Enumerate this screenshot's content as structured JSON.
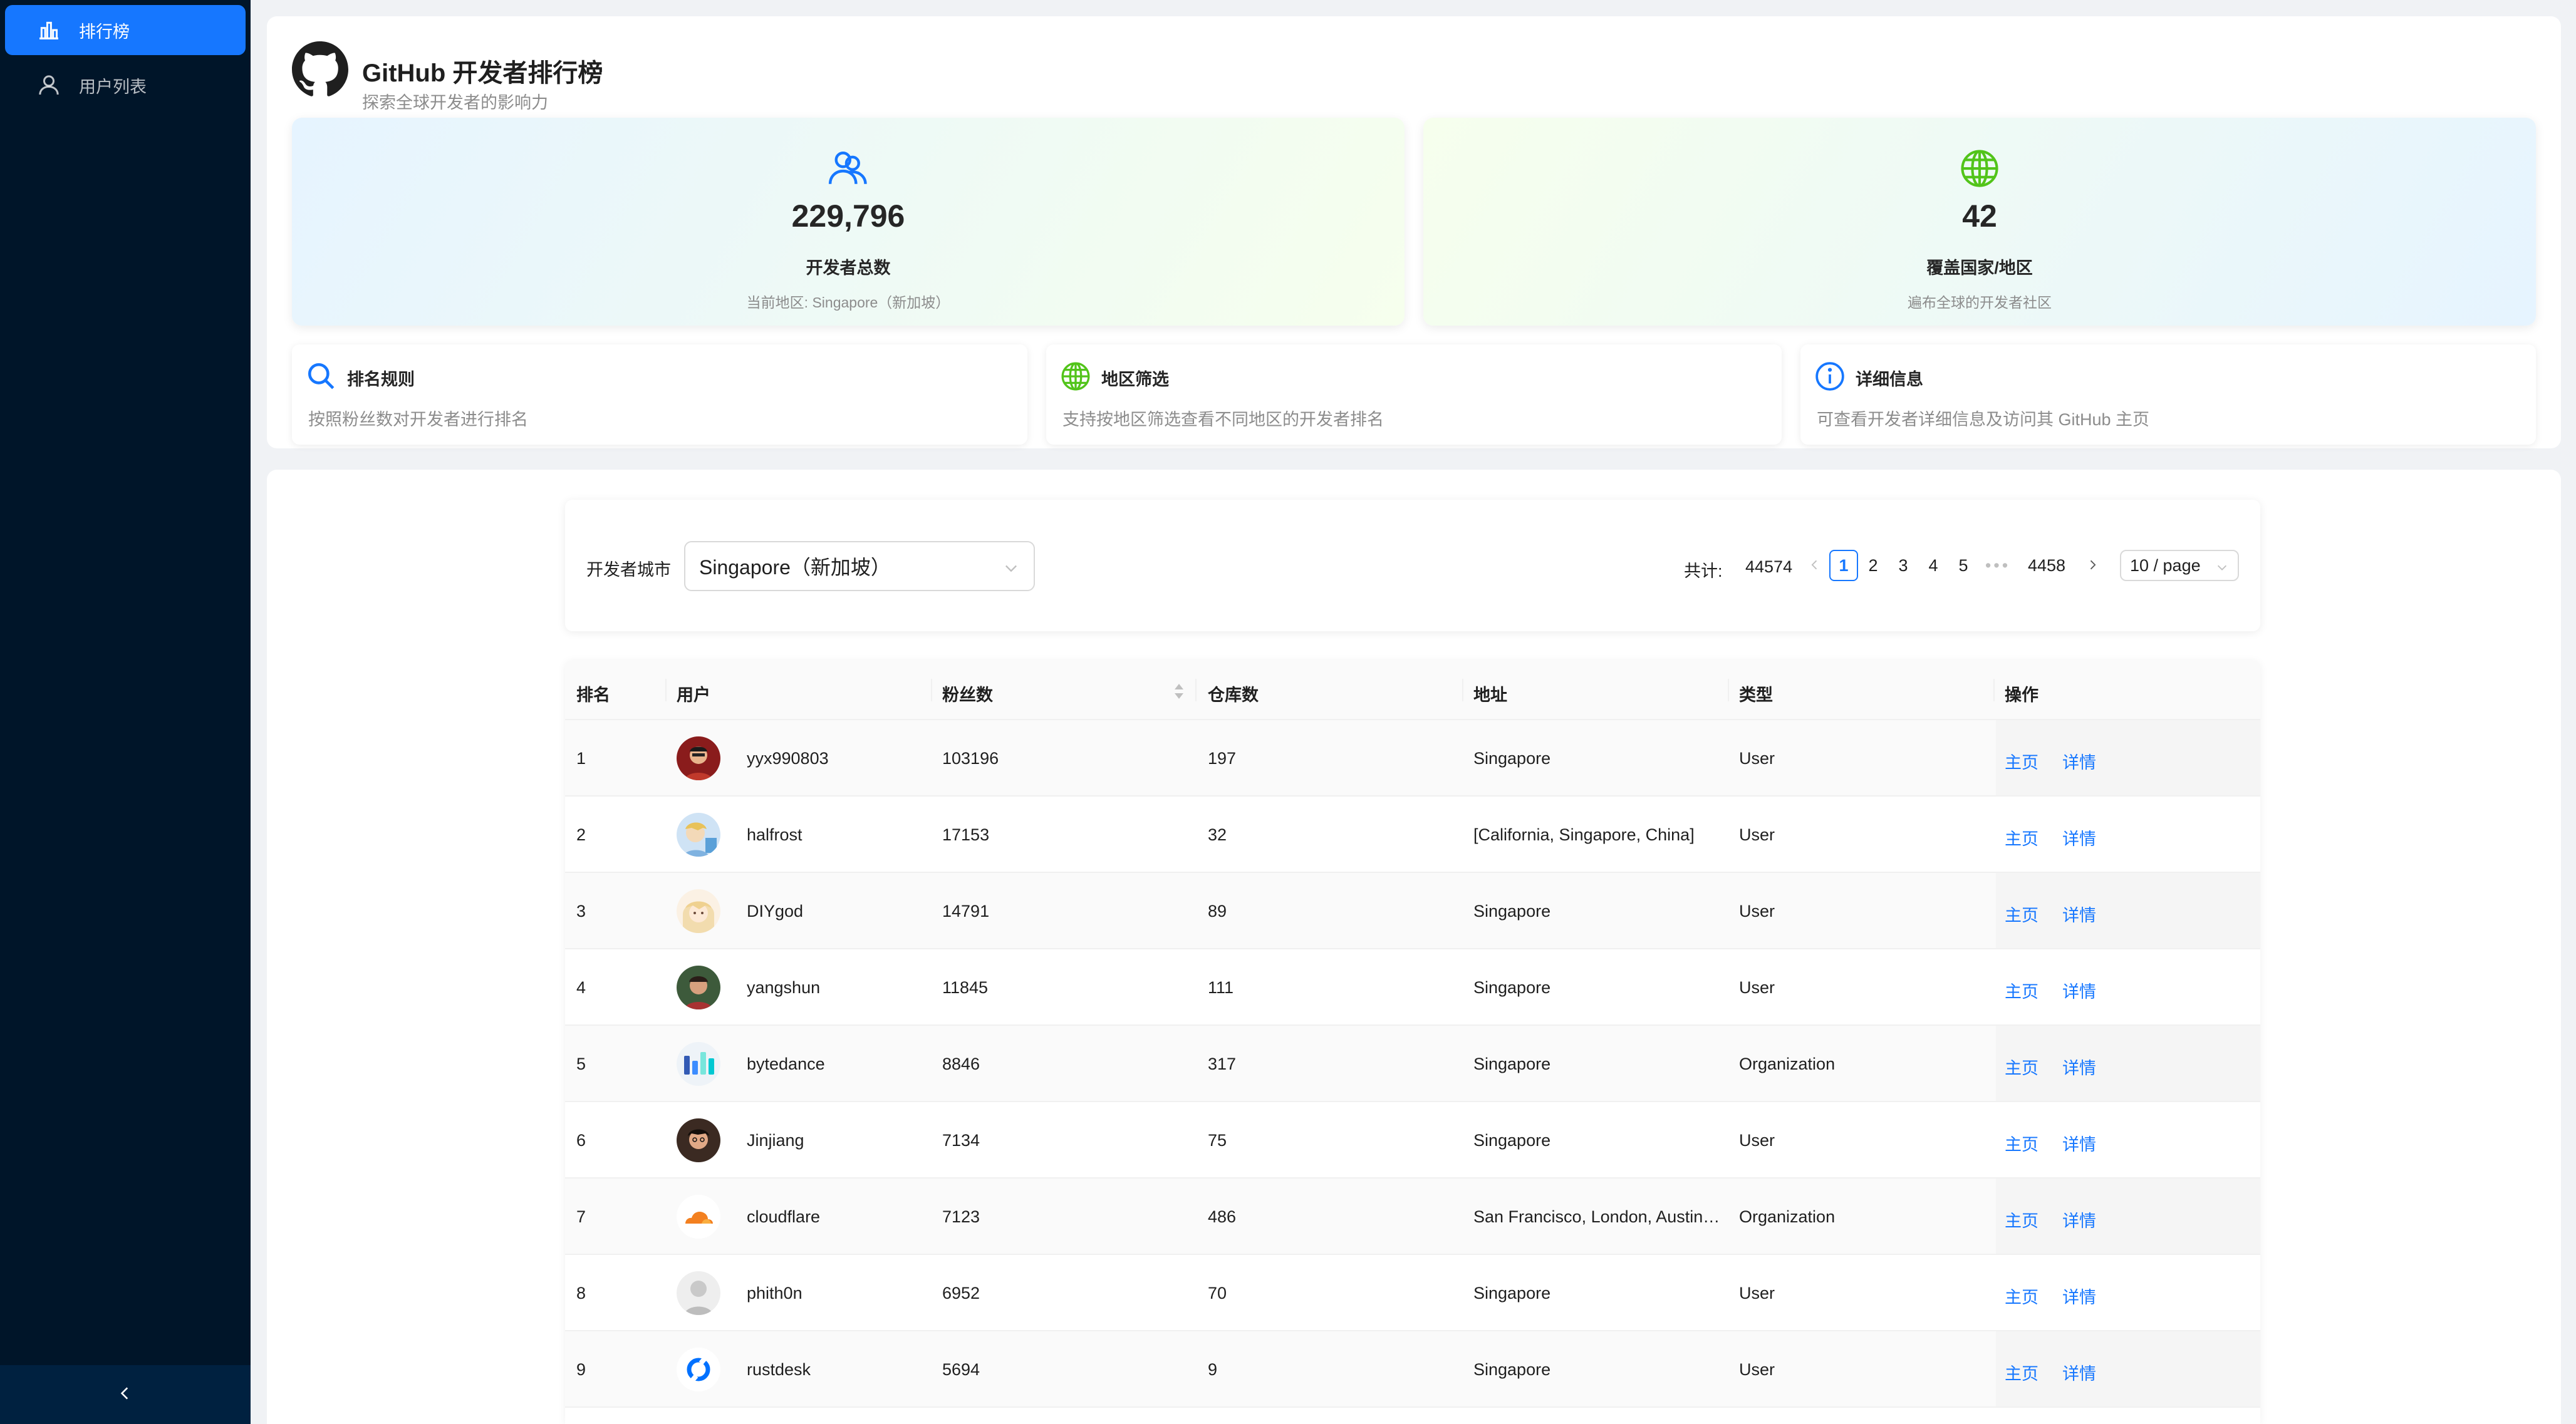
{
  "sidebar": {
    "items": [
      {
        "label": "排行榜",
        "icon": "bar-chart-icon",
        "active": true
      },
      {
        "label": "用户列表",
        "icon": "user-icon",
        "active": false
      }
    ],
    "collapse_icon": "chevron-left-icon"
  },
  "header": {
    "title": "GitHub 开发者排行榜",
    "subtitle": "探索全球开发者的影响力",
    "logo_icon": "github-icon"
  },
  "stats": {
    "developers": {
      "value": "229,796",
      "label": "开发者总数",
      "note": "当前地区: Singapore（新加坡）",
      "icon": "team-icon",
      "icon_color": "#1677ff"
    },
    "countries": {
      "value": "42",
      "label": "覆盖国家/地区",
      "note": "遍布全球的开发者社区",
      "icon": "globe-icon",
      "icon_color": "#52c41a"
    }
  },
  "info_cards": [
    {
      "title": "排名规则",
      "desc": "按照粉丝数对开发者进行排名",
      "icon": "search-icon",
      "color": "#1677ff"
    },
    {
      "title": "地区筛选",
      "desc": "支持按地区筛选查看不同地区的开发者排名",
      "icon": "globe-icon",
      "color": "#52c41a"
    },
    {
      "title": "详细信息",
      "desc": "可查看开发者详细信息及访问其 GitHub 主页",
      "icon": "info-icon",
      "color": "#1677ff"
    }
  ],
  "filter": {
    "label": "开发者城市",
    "selected": "Singapore（新加坡）",
    "total_label": "共计:",
    "total_value": "44574",
    "pages": [
      "1",
      "2",
      "3",
      "4",
      "5"
    ],
    "current_page": "1",
    "ellipsis": "•••",
    "last_page": "4458",
    "page_size": "10 / page"
  },
  "table": {
    "columns": [
      "排名",
      "用户",
      "粉丝数",
      "仓库数",
      "地址",
      "类型",
      "操作"
    ],
    "action_home": "主页",
    "action_detail": "详情",
    "rows": [
      {
        "rank": "1",
        "user": "yyx990803",
        "followers": "103196",
        "repos": "197",
        "address": "Singapore",
        "type": "User"
      },
      {
        "rank": "2",
        "user": "halfrost",
        "followers": "17153",
        "repos": "32",
        "address": "[California, Singapore, China]",
        "type": "User"
      },
      {
        "rank": "3",
        "user": "DIYgod",
        "followers": "14791",
        "repos": "89",
        "address": "Singapore",
        "type": "User"
      },
      {
        "rank": "4",
        "user": "yangshun",
        "followers": "11845",
        "repos": "111",
        "address": "Singapore",
        "type": "User"
      },
      {
        "rank": "5",
        "user": "bytedance",
        "followers": "8846",
        "repos": "317",
        "address": "Singapore",
        "type": "Organization"
      },
      {
        "rank": "6",
        "user": "Jinjiang",
        "followers": "7134",
        "repos": "75",
        "address": "Singapore",
        "type": "User"
      },
      {
        "rank": "7",
        "user": "cloudflare",
        "followers": "7123",
        "repos": "486",
        "address": "San Francisco, London, Austin, Singapore",
        "type": "Organization"
      },
      {
        "rank": "8",
        "user": "phith0n",
        "followers": "6952",
        "repos": "70",
        "address": "Singapore",
        "type": "User"
      },
      {
        "rank": "9",
        "user": "rustdesk",
        "followers": "5694",
        "repos": "9",
        "address": "Singapore",
        "type": "User"
      }
    ]
  }
}
